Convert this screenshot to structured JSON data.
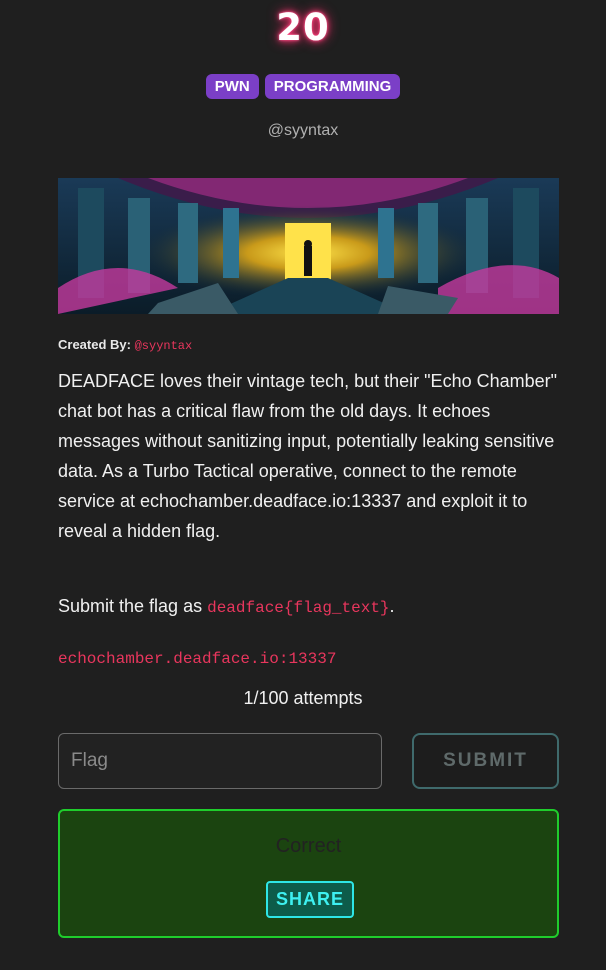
{
  "challenge": {
    "points": "20",
    "tags": [
      "PWN",
      "PROGRAMMING"
    ],
    "author_handle": "@syyntax",
    "created_by_label": "Created By:",
    "created_by_handle": "@syyntax",
    "description": "DEADFACE loves their vintage tech, but their \"Echo Chamber\" chat bot has a critical flaw from the old days. It echoes messages without sanitizing input, potentially leaking sensitive data. As a Turbo Tactical operative, connect to the remote service at echochamber.deadface.io:13337 and exploit it to reveal a hidden flag.",
    "submit_prefix": "Submit the flag as ",
    "flag_format": "deadface{flag_text}",
    "submit_suffix": ".",
    "service": "echochamber.deadface.io:13337",
    "attempts": "1/100 attempts"
  },
  "form": {
    "flag_placeholder": "Flag",
    "submit_label": "SUBMIT"
  },
  "result": {
    "message": "Correct",
    "share_label": "SHARE"
  },
  "colors": {
    "background": "#1f1f1f",
    "tag": "#7b3fc7",
    "code": "#e8365d",
    "success_bg": "#1b4410",
    "success_border": "#1fcd2c",
    "share": "#2ee6e6"
  }
}
